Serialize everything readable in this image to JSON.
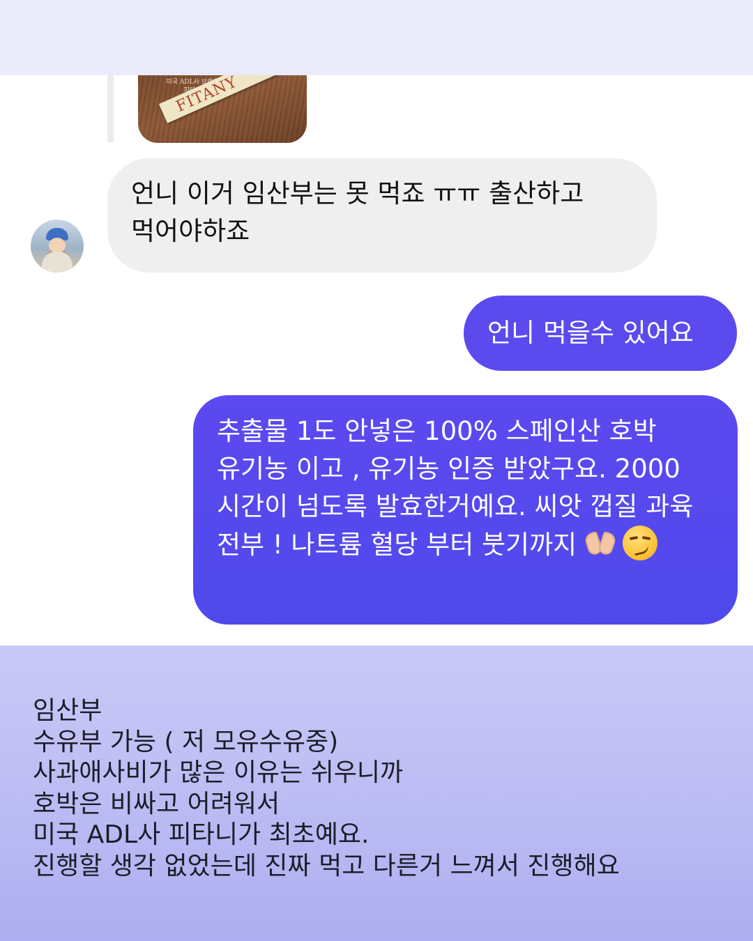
{
  "shared_image": {
    "brand": "FITANY",
    "caption": "미국 ADL사 브랜드\n피타니"
  },
  "messages": [
    {
      "sender": "other",
      "text": "언니 이거 임산부는 못 먹죠 ㅠㅠ 출산하고 먹어야하죠"
    },
    {
      "sender": "me",
      "text": "언니 먹을수 있어요"
    },
    {
      "sender": "me",
      "text": "추출물 1도 안넣은 100% 스페인산 호박 유기농 이고 , 유기농 인증 받았구요. 2000 시간이 넘도록 발효한거예요. 씨앗 껍질 과육 전부 ! 나트륨 혈당 부터 붓기까지",
      "emojis": [
        "heart-hands",
        "smirking-face"
      ]
    }
  ],
  "caption": {
    "lines": [
      "임산부",
      "수유부 가능 ( 저 모유수유중)",
      "사과애사비가 많은 이유는 쉬우니까",
      "호박은 비싸고 어려워서",
      "미국 ADL사 피타니가 최초예요.",
      "진행할 생각 없었는데 진짜 먹고 다른거 느껴서 진행해요"
    ]
  },
  "colors": {
    "top_band": "#eaeafb",
    "incoming_bubble": "#efefef",
    "outgoing_bubble": "#5b4bee",
    "caption_panel": "#bdbdf4"
  }
}
